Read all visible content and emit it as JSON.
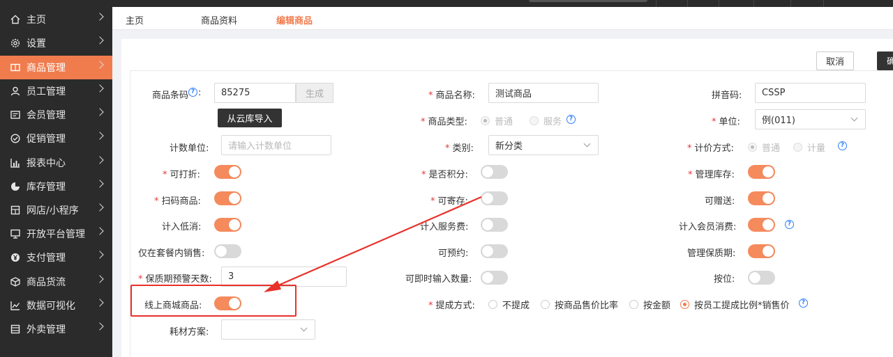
{
  "sidebar": {
    "items": [
      {
        "label": "主页",
        "icon": "home-icon"
      },
      {
        "label": "设置",
        "icon": "gear-icon"
      },
      {
        "label": "商品管理",
        "icon": "book-icon",
        "active": true
      },
      {
        "label": "员工管理",
        "icon": "user-icon"
      },
      {
        "label": "会员管理",
        "icon": "member-card-icon"
      },
      {
        "label": "促销管理",
        "icon": "check-circle-icon"
      },
      {
        "label": "报表中心",
        "icon": "bar-chart-icon"
      },
      {
        "label": "库存管理",
        "icon": "pie-chart-icon"
      },
      {
        "label": "网店/小程序",
        "icon": "shop-icon"
      },
      {
        "label": "开放平台管理",
        "icon": "monitor-icon"
      },
      {
        "label": "支付管理",
        "icon": "yen-icon"
      },
      {
        "label": "商品货流",
        "icon": "box-icon"
      },
      {
        "label": "数据可视化",
        "icon": "line-chart-icon"
      },
      {
        "label": "外卖管理",
        "icon": "store-icon"
      }
    ]
  },
  "tabs": [
    {
      "label": "主页"
    },
    {
      "label": "商品资料"
    },
    {
      "label": "编辑商品",
      "active": true
    }
  ],
  "toolbar": {
    "cancel_label": "取消",
    "confirm_label": "确"
  },
  "form": {
    "barcode_label": "商品条码",
    "barcode_value": "85275",
    "generate_label": "生成",
    "import_label": "从云库导入",
    "name_label": "商品名称:",
    "name_value": "测试商品",
    "pinyin_label": "拼音码:",
    "pinyin_value": "CSSP",
    "type_label": "商品类型:",
    "type_options": [
      "普通",
      "服务"
    ],
    "unit_label": "单位:",
    "unit_value": "例(011)",
    "count_unit_label": "计数单位:",
    "count_unit_placeholder": "请输入计数单位",
    "category_label": "类别:",
    "category_value": "新分类",
    "pricing_label": "计价方式:",
    "pricing_options": [
      "普通",
      "计量"
    ],
    "discount_label": "可打折:",
    "points_label": "是否积分:",
    "stock_label": "管理库存:",
    "scan_label": "扫码商品:",
    "deposit_label": "可寄存:",
    "gift_label": "可赠送:",
    "min_spend_label": "计入低消:",
    "service_fee_label": "计入服务费:",
    "member_spend_label": "计入会员消费:",
    "combo_only_label": "仅在套餐内销售:",
    "reservable_label": "可预约:",
    "shelf_life_label": "管理保质期:",
    "warning_days_label": "保质期预警天数:",
    "warning_days_value": "3",
    "instant_qty_label": "可即时输入数量:",
    "by_position_label": "按位:",
    "online_label": "线上商城商品:",
    "commission_label": "提成方式:",
    "commission_options": [
      "不提成",
      "按商品售价比率",
      "按金额",
      "按员工提成比例*销售价"
    ],
    "material_label": "耗材方案:",
    "toggles": {
      "discount": true,
      "points": false,
      "stock": true,
      "scan": true,
      "deposit": false,
      "gift": true,
      "min_spend": true,
      "service_fee": false,
      "member_spend": true,
      "combo_only": false,
      "reservable": false,
      "shelf_life": true,
      "instant_qty": false,
      "by_position": false,
      "online": true
    }
  },
  "colors": {
    "accent": "#f07c4e",
    "annotation": "#e8312a",
    "sidebar_bg": "#2b2b2b"
  }
}
